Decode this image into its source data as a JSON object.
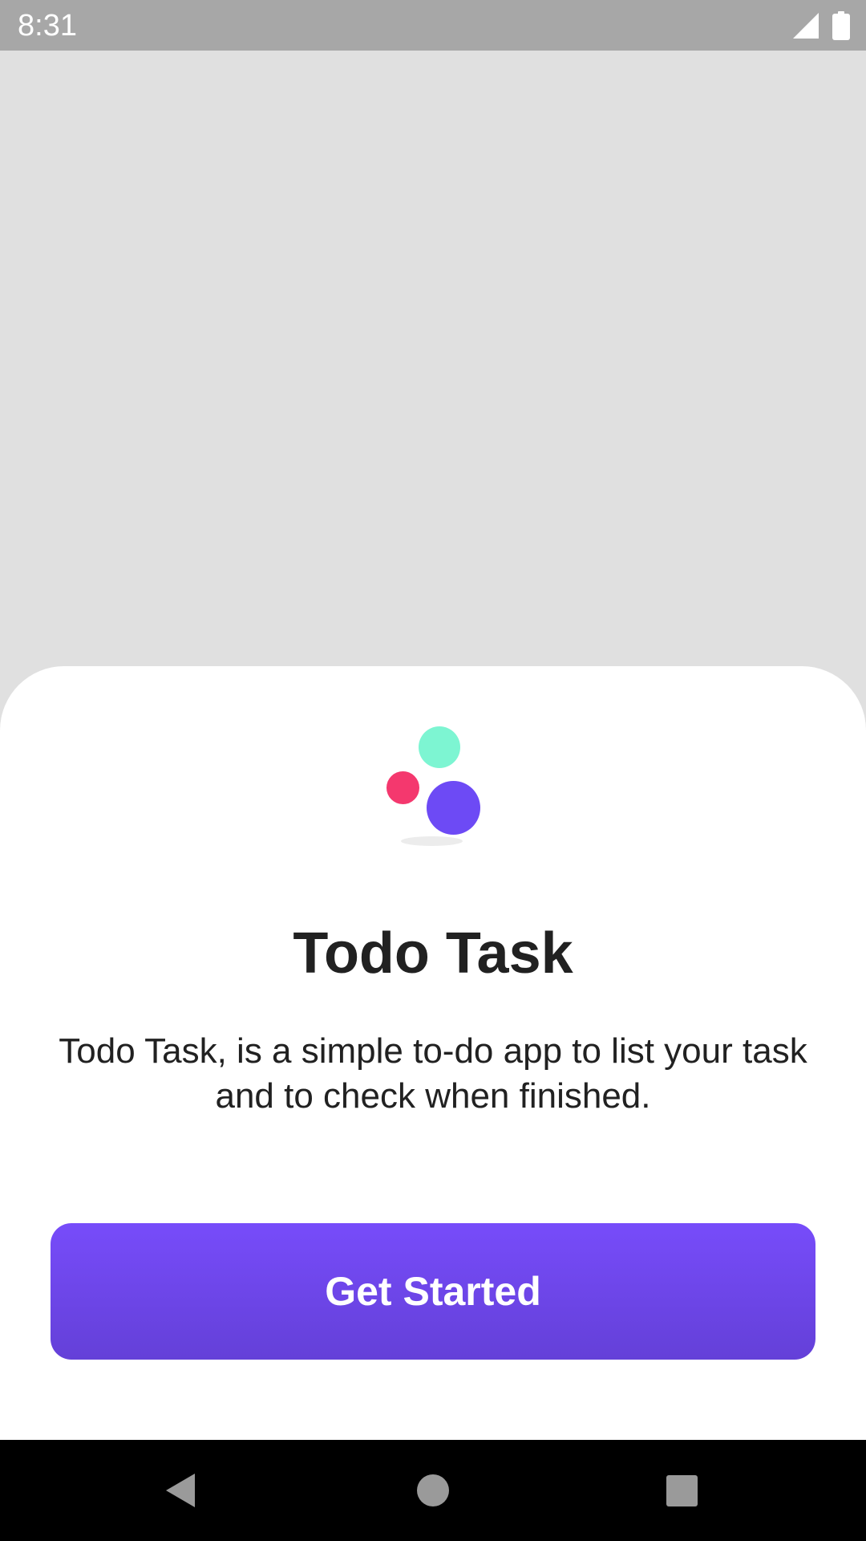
{
  "status_bar": {
    "time": "8:31",
    "icons": [
      "signal-icon",
      "battery-icon"
    ]
  },
  "welcome": {
    "logo": "todo-task-logo",
    "title": "Todo Task",
    "description": "Todo Task, is a simple to-do app to list your task and to check when finished.",
    "button_label": "Get Started"
  },
  "colors": {
    "accent": "#6d4af5",
    "button_top": "#774cfa",
    "button_bottom": "#6440d8",
    "logo_green": "#7df5d2",
    "logo_pink": "#f4386e",
    "logo_purple": "#6d4af5",
    "text": "#212121",
    "background": "#e0e0e0"
  },
  "nav_bar": {
    "icons": [
      "back-icon",
      "home-icon",
      "recents-icon"
    ]
  }
}
